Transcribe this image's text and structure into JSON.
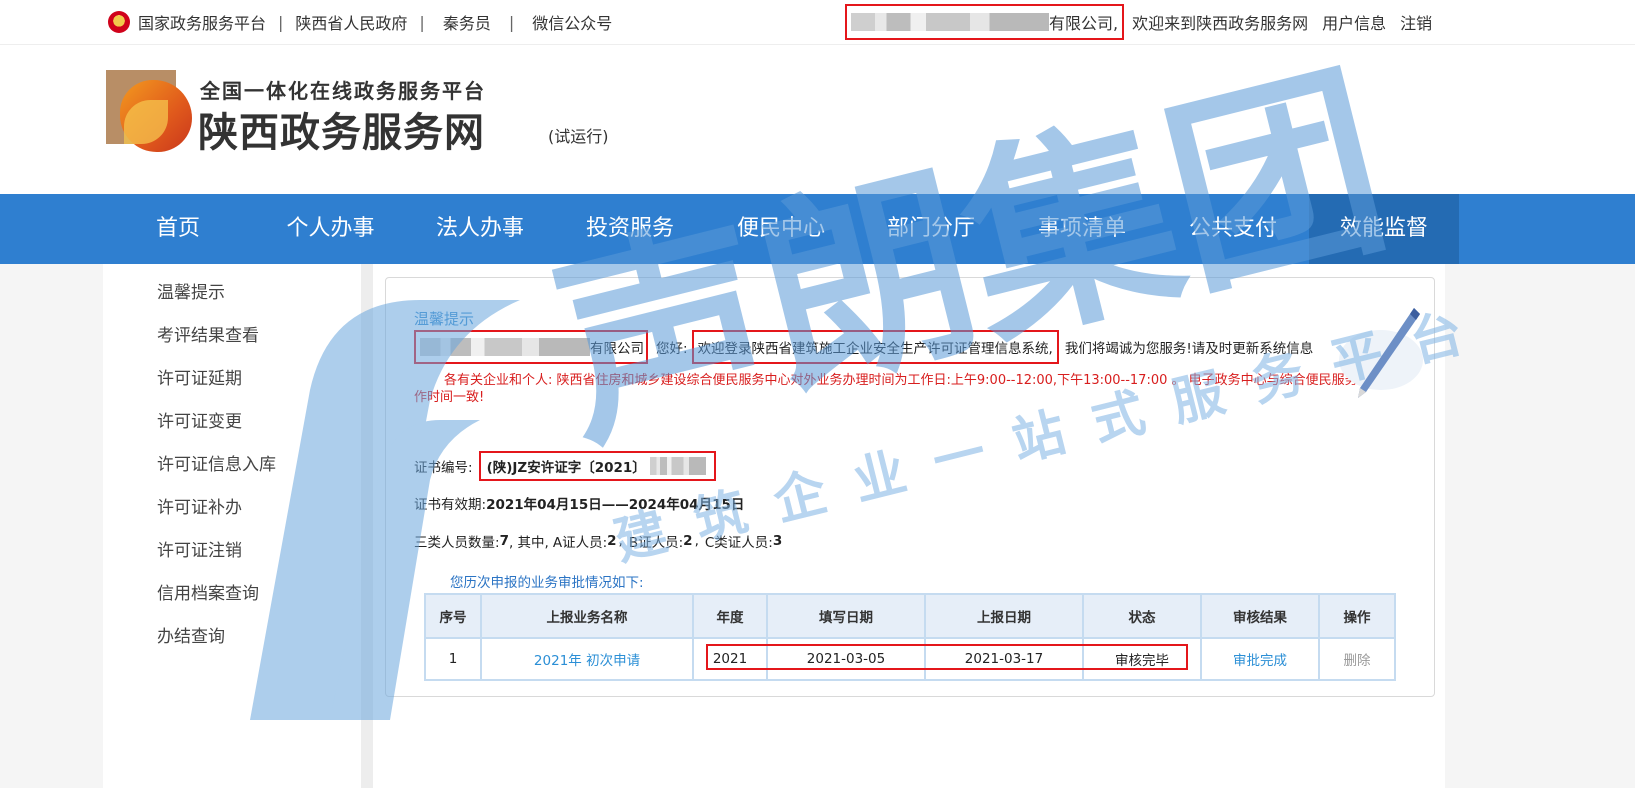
{
  "topbar": {
    "links": [
      "国家政务服务平台",
      "陕西省人民政府",
      "秦务员",
      "微信公众号"
    ],
    "separator": "|",
    "company_suffix": "有限公司,",
    "welcome": "欢迎来到陕西政务服务网",
    "user_info": "用户信息",
    "logout": "注销"
  },
  "header": {
    "slogan": "全国一体化在线政务服务平台",
    "site_name": "陕西政务服务网",
    "trial": "(试运行)"
  },
  "nav": {
    "items": [
      "首页",
      "个人办事",
      "法人办事",
      "投资服务",
      "便民中心",
      "部门分厅",
      "事项清单",
      "公共支付",
      "效能监督"
    ],
    "active_index": 8
  },
  "sidebar": {
    "items": [
      "温馨提示",
      "考评结果查看",
      "许可证延期",
      "许可证变更",
      "许可证信息入库",
      "许可证补办",
      "许可证注销",
      "信用档案查询",
      "办结查询"
    ]
  },
  "main": {
    "tip_title": "温馨提示",
    "greet_company_suffix": "有限公司",
    "greet_hello": "您好:",
    "greet_welcome": "欢迎登录陕西省建筑施工企业安全生产许可证管理信息系统,",
    "greet_service": "我们将竭诚为您服务!请及时更新系统信息",
    "notice": "各有关企业和个人: 陕西省住房和城乡建设综合便民服务中心对外业务办理时间为工作日:上午9:00--12:00,下午13:00--17:00 。 电子政务中心与综合便民服务中心工作时间一致!",
    "cert_label": "证书编号:",
    "cert_value": "(陕)JZ安许证字〔2021〕",
    "valid_label": "证书有效期:",
    "valid_value": "2021年04月15日——2024年04月15日",
    "count_label": "三类人员数量:",
    "count_total": "7",
    "count_among": ", 其中,",
    "count_a_label": "A证人员:",
    "count_a": "2",
    "count_b_label": "B证人员:",
    "count_b": "2",
    "count_c_label": "C类证人员:",
    "count_c": "3",
    "history_label": "您历次申报的业务审批情况如下:",
    "table": {
      "headers": [
        "序号",
        "上报业务名称",
        "年度",
        "填写日期",
        "上报日期",
        "状态",
        "审核结果",
        "操作"
      ],
      "rows": [
        [
          "1",
          "2021年 初次申请",
          "2021",
          "2021-03-05",
          "2021-03-17",
          "审核完毕",
          "审批完成",
          "删除"
        ]
      ]
    }
  },
  "watermark": {
    "big": "声朗集团",
    "line1": "建筑企业一站式服务平台"
  },
  "colors": {
    "nav_bg": "#2f7fd0",
    "nav_active": "#246bb3",
    "highlight_red": "#e4161b",
    "notice_red": "#d81e1e",
    "link_blue": "#2b8fd6",
    "watermark_blue": "#4a90d6"
  }
}
